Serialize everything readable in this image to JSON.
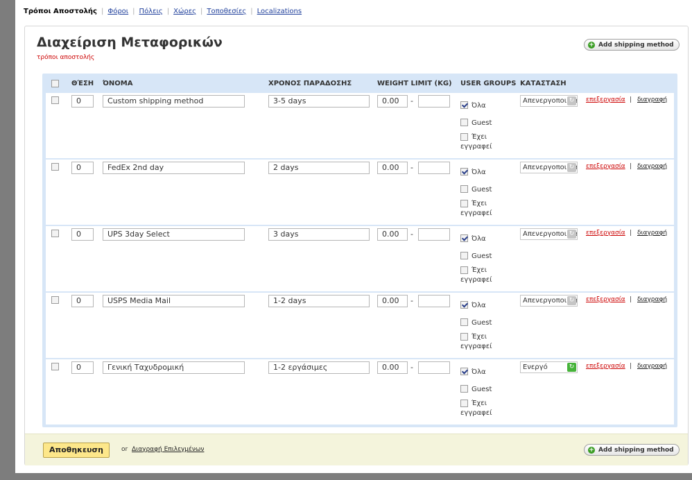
{
  "topnav": [
    "Τρόποι Αποστολής",
    "Φόροι",
    "Πόλεις",
    "Χώρες",
    "Τοποθεσίες",
    "Localizations"
  ],
  "header": {
    "title": "Διαχείριση Μεταφορικών",
    "subtitle": "τρόποι αποστολής",
    "add_label": "Add shipping method"
  },
  "columns": {
    "position": "ΘΈΣΗ",
    "name": "ΌΝΟΜΑ",
    "delivery": "ΧΡΟΝΟΣ ΠΑΡΑΔΟΣΗΣ",
    "weight": "WEIGHT LIMIT (KG)",
    "groups": "USER GROUPS",
    "status": "ΚΑΤΑΣΤΑΣΗ"
  },
  "user_groups": [
    "Όλα",
    "Guest",
    "Έχει εγγραφεί"
  ],
  "rows": [
    {
      "position": "0",
      "name": "Custom shipping method",
      "delivery": "3-5 days",
      "weight_min": "0.00",
      "weight_sep": "-",
      "weight_max": "",
      "groups_checked": [
        true,
        false,
        false
      ],
      "status": "Απενεργοποιημένο",
      "active": false,
      "edit": "επεξεργασία",
      "sep": "|",
      "delete": "διαγραφή"
    },
    {
      "position": "0",
      "name": "FedEx 2nd day",
      "delivery": "2 days",
      "weight_min": "0.00",
      "weight_sep": "-",
      "weight_max": "",
      "groups_checked": [
        true,
        false,
        false
      ],
      "status": "Απενεργοποιημένο",
      "active": false,
      "edit": "επεξεργασία",
      "sep": "|",
      "delete": "διαγραφή"
    },
    {
      "position": "0",
      "name": "UPS 3day Select",
      "delivery": "3 days",
      "weight_min": "0.00",
      "weight_sep": "-",
      "weight_max": "",
      "groups_checked": [
        true,
        false,
        false
      ],
      "status": "Απενεργοποιημένο",
      "active": false,
      "edit": "επεξεργασία",
      "sep": "|",
      "delete": "διαγραφή"
    },
    {
      "position": "0",
      "name": "USPS Media Mail",
      "delivery": "1-2 days",
      "weight_min": "0.00",
      "weight_sep": "-",
      "weight_max": "",
      "groups_checked": [
        true,
        false,
        false
      ],
      "status": "Απενεργοποιημένο",
      "active": false,
      "edit": "επεξεργασία",
      "sep": "|",
      "delete": "διαγραφή"
    },
    {
      "position": "0",
      "name": "Γενική Ταχυδρομική",
      "delivery": "1-2 εργάσιμες",
      "weight_min": "0.00",
      "weight_sep": "-",
      "weight_max": "",
      "groups_checked": [
        true,
        false,
        false
      ],
      "status": "Ενεργό",
      "active": true,
      "edit": "επεξεργασία",
      "sep": "|",
      "delete": "διαγραφή"
    }
  ],
  "footer": {
    "save_label": "Αποθηκευση",
    "or_text": "or",
    "delete_selected": "Διαγραφή Επιλεγμένων"
  },
  "icons": {
    "add": "plus-circle-icon",
    "status_toggle": "refresh-icon"
  },
  "colors": {
    "accent_red": "#cc0000",
    "table_bg": "#d7e6f7",
    "active_green": "#46b33a",
    "save_button": "#fde78a"
  }
}
